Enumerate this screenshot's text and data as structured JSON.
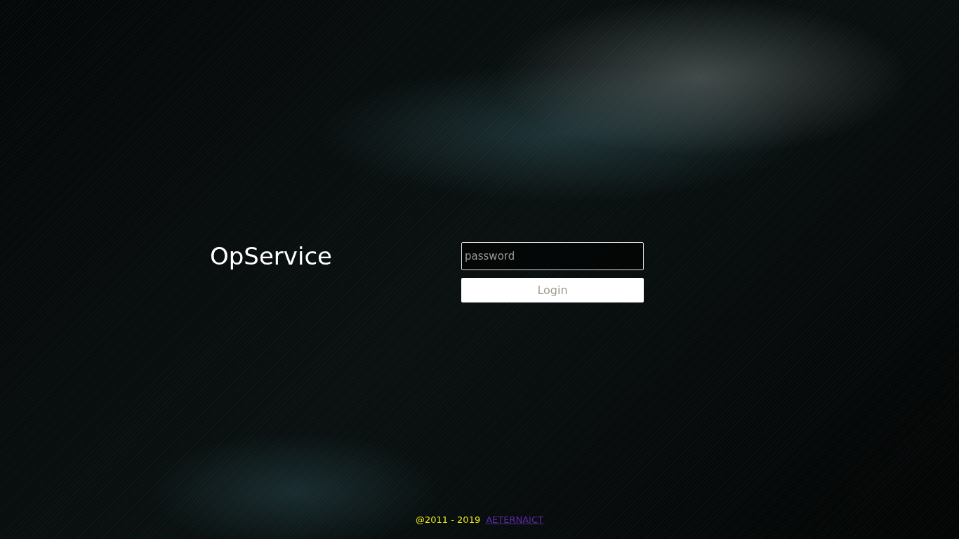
{
  "brand": {
    "title": "OpService"
  },
  "login_form": {
    "password": {
      "placeholder": "password"
    },
    "button": "Login"
  },
  "footer": {
    "copyright": "@2011 - 2019",
    "link": "AETERNAICT"
  }
}
